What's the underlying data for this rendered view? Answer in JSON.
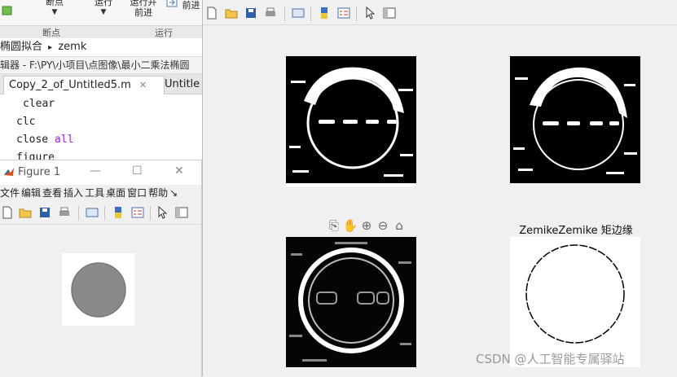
{
  "ribbon": {
    "btn_breakpoints": "断点",
    "btn_run": "运行",
    "btn_run_advance_top": "运行并",
    "btn_run_advance_bottom": "前进",
    "btn_advance": "前进",
    "group_breakpoints": "断点",
    "group_run": "运行"
  },
  "breadcrumb": {
    "folder": "椭圆拟合",
    "sep": "▸",
    "file": "zemk"
  },
  "editor": {
    "path": "辑器 - F:\\PY\\小项目\\点图像\\最小二乘法椭圆"
  },
  "tabs": [
    {
      "label": "Copy_2_of_Untitled5.m",
      "close": "✕"
    },
    {
      "label": "Untitle"
    }
  ],
  "code": [
    {
      "text": "clear"
    },
    {
      "text": "clc"
    },
    {
      "text": "close ",
      "kw": "all"
    },
    {
      "text": "figure"
    }
  ],
  "figure1": {
    "title": "Figure 1",
    "controls": {
      "minimize": "—",
      "maximize": "☐",
      "close": "✕"
    },
    "menu": [
      "文件",
      "编辑",
      "查看",
      "插入",
      "工具",
      "桌面",
      "窗口",
      "帮助"
    ],
    "menu_more": "↘"
  },
  "axes_toolbar": {
    "icons": [
      "export-icon",
      "pan-hand-icon",
      "zoom-in-icon",
      "zoom-out-icon",
      "home-icon"
    ]
  },
  "subplot_title": "ZemikeZemike 矩边缘",
  "watermark": "CSDN @人工智能专属驿站",
  "colors": {
    "axes_bg": "#000000",
    "edge": "#ffffff",
    "circle_fill": "#8a8a8a"
  }
}
